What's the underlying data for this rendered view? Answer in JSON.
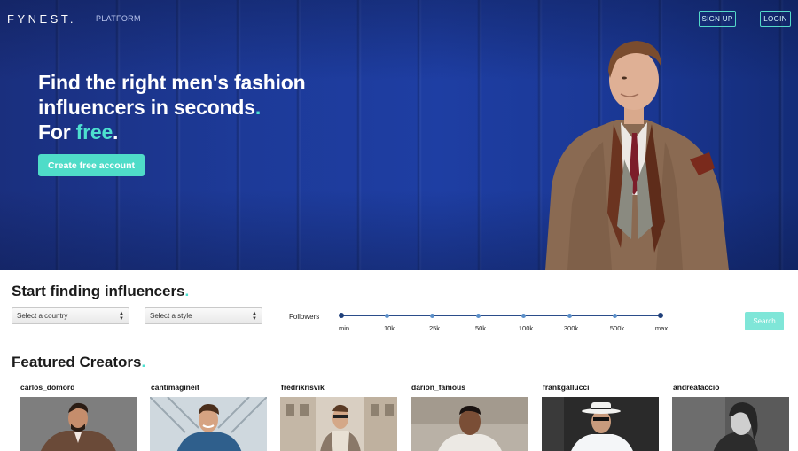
{
  "brand": {
    "logo": "FYNEST.",
    "accent": "#4fdcc8",
    "hero_blue": "#1e3ea3"
  },
  "nav": {
    "platform": "PLATFORM",
    "signup": "SIGN UP",
    "login": "LOGIN"
  },
  "hero": {
    "line1": "Find the right men's fashion",
    "line2_main": "influencers in seconds",
    "line2_dot": ".",
    "line3_prefix": "For ",
    "line3_highlight": "free",
    "line3_dot": ".",
    "cta": "Create free account"
  },
  "search": {
    "title": "Start finding influencers",
    "title_dot": ".",
    "country_placeholder": "Select a country",
    "style_placeholder": "Select a style",
    "followers_label": "Followers",
    "ticks": [
      "min",
      "10k",
      "25k",
      "50k",
      "100k",
      "300k",
      "500k",
      "max"
    ],
    "button": "Search"
  },
  "featured": {
    "title": "Featured Creators",
    "title_dot": ".",
    "creators": [
      {
        "name": "carlos_domord"
      },
      {
        "name": "cantimagineit"
      },
      {
        "name": "fredrikrisvik"
      },
      {
        "name": "darion_famous"
      },
      {
        "name": "frankgallucci"
      },
      {
        "name": "andreafaccio"
      }
    ]
  }
}
